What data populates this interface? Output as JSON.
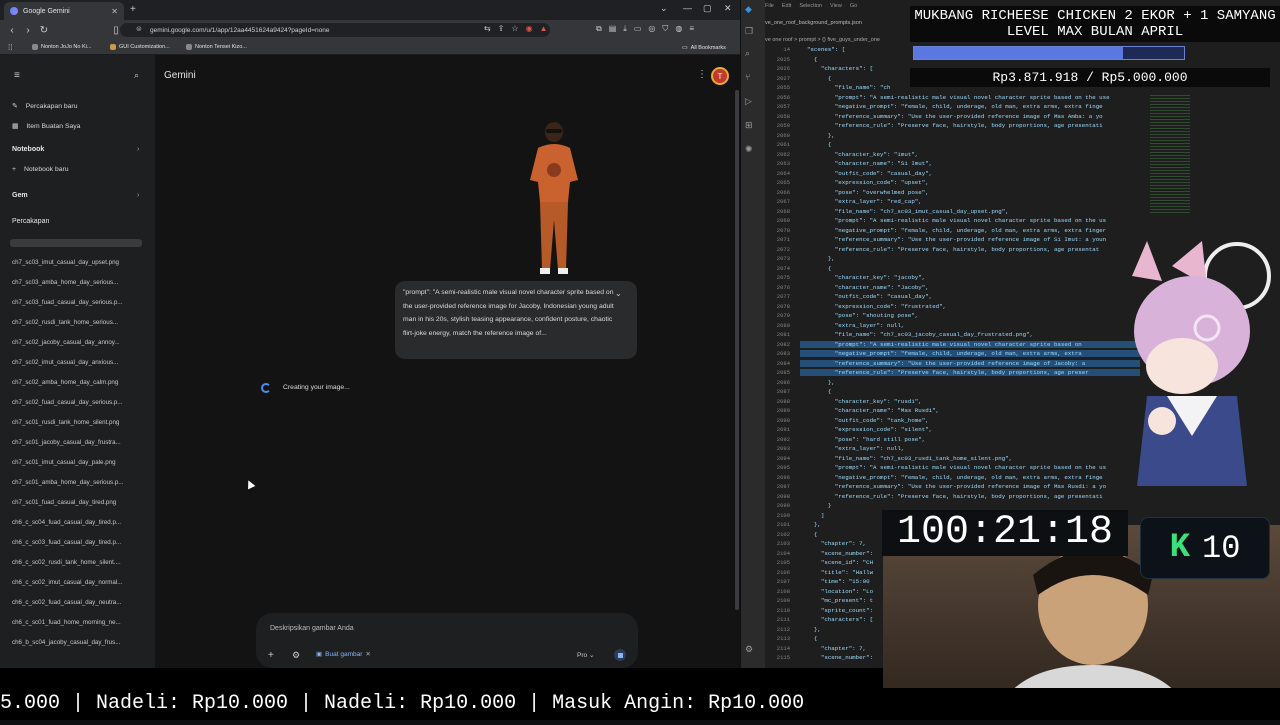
{
  "browser": {
    "tab_title": "Google Gemini",
    "url": "gemini.google.com/u/1/app/12aa4451624a9424?pageId=none",
    "bookmarks": [
      "Nonton JoJo No Ki...",
      "GUI Customization...",
      "Nonton Tensei Kizo..."
    ],
    "all_bookmarks": "All Bookmarks"
  },
  "gemini": {
    "title": "Gemini",
    "avatar_initial": "T",
    "sidebar": {
      "new_chat": "Percakapan baru",
      "my_items": "Item Buatan Saya",
      "notebook_head": "Notebook",
      "new_notebook": "Notebook baru",
      "gem_head": "Gem",
      "chats_head": "Percakapan",
      "history": [
        "ch7_sc03_imut_casual_day_upset.png",
        "ch7_sc03_amba_home_day_serious...",
        "ch7_sc03_fuad_casual_day_serious.p...",
        "ch7_sc02_rusdi_tank_home_serious...",
        "ch7_sc02_jacoby_casual_day_annoy...",
        "ch7_sc02_imut_casual_day_anxious...",
        "ch7_sc02_amba_home_day_calm.png",
        "ch7_sc02_fuad_casual_day_serious.p...",
        "ch7_sc01_rusdi_tank_home_silent.png",
        "ch7_sc01_jacoby_casual_day_frustra...",
        "ch7_sc01_imut_casual_day_pale.png",
        "ch7_sc01_amba_home_day_serious.p...",
        "ch7_sc01_fuad_casual_day_tired.png",
        "ch6_c_sc04_fuad_casual_day_tired.p...",
        "ch6_c_sc03_fuad_casual_day_tired.p...",
        "ch6_c_sc02_rusdi_tank_home_silent....",
        "ch6_c_sc02_imut_casual_day_normal...",
        "ch6_c_sc02_fuad_casual_day_neutra...",
        "ch6_c_sc01_fuad_home_morning_ne...",
        "ch6_b_sc04_jacoby_casual_day_frus..."
      ]
    },
    "prompt_text": "\"prompt\": \"A semi-realistic male visual novel character sprite based on the user-provided reference image for Jacoby, Indonesian young adult man in his 20s, stylish teasing appearance, confident posture, chaotic flirt-joke energy, match the reference image of...",
    "status": "Creating your image...",
    "input_placeholder": "Deskripsikan gambar Anda",
    "chip_label": "Buat gambar",
    "model": "Pro"
  },
  "editor": {
    "menu": [
      "File",
      "Edit",
      "Selection",
      "View",
      "Go"
    ],
    "file_tab": "ve_one_roof_background_prompts.json",
    "breadcrumb": "ve one roof > prompt > {} five_guys_under_one",
    "lines": [
      {
        "n": "14",
        "t": "  \"scenes\": ["
      },
      {
        "n": "2025",
        "t": "    {"
      },
      {
        "n": "2026",
        "t": "      \"characters\": ["
      },
      {
        "n": "2027",
        "t": "        {"
      },
      {
        "n": "2055",
        "t": "          \"file_name\": \"ch"
      },
      {
        "n": "2056",
        "t": "          \"prompt\": \"A semi-realistic male visual novel character sprite based on the use"
      },
      {
        "n": "2057",
        "t": "          \"negative_prompt\": \"female, child, underage, old man, extra arms, extra finge"
      },
      {
        "n": "2058",
        "t": "          \"reference_summary\": \"Use the user-provided reference image of Mas Amba: a yo"
      },
      {
        "n": "2059",
        "t": "          \"reference_rule\": \"Preserve face, hairstyle, body proportions, age presentati"
      },
      {
        "n": "2060",
        "t": "        },"
      },
      {
        "n": "2061",
        "t": "        {"
      },
      {
        "n": "2062",
        "t": "          \"character_key\": \"imut\","
      },
      {
        "n": "2063",
        "t": "          \"character_name\": \"Si Imut\","
      },
      {
        "n": "2064",
        "t": "          \"outfit_code\": \"casual_day\","
      },
      {
        "n": "2065",
        "t": "          \"expression_code\": \"upset\","
      },
      {
        "n": "2066",
        "t": "          \"pose\": \"overwhelmed pose\","
      },
      {
        "n": "2067",
        "t": "          \"extra_layer\": \"red_cap\","
      },
      {
        "n": "2068",
        "t": "          \"file_name\": \"ch7_sc03_imut_casual_day_upset.png\","
      },
      {
        "n": "2069",
        "t": "          \"prompt\": \"A semi-realistic male visual novel character sprite based on the us"
      },
      {
        "n": "2070",
        "t": "          \"negative_prompt\": \"female, child, underage, old man, extra arms, extra finger"
      },
      {
        "n": "2071",
        "t": "          \"reference_summary\": \"Use the user-provided reference image of Si Imut: a youn"
      },
      {
        "n": "2072",
        "t": "          \"reference_rule\": \"Preserve face, hairstyle, body proportions, age presentat"
      },
      {
        "n": "2073",
        "t": "        },"
      },
      {
        "n": "2074",
        "t": "        {"
      },
      {
        "n": "2075",
        "t": "          \"character_key\": \"jacoby\","
      },
      {
        "n": "2076",
        "t": "          \"character_name\": \"Jacoby\","
      },
      {
        "n": "2077",
        "t": "          \"outfit_code\": \"casual_day\","
      },
      {
        "n": "2078",
        "t": "          \"expression_code\": \"frustrated\","
      },
      {
        "n": "2079",
        "t": "          \"pose\": \"shouting pose\","
      },
      {
        "n": "2080",
        "t": "          \"extra_layer\": null,"
      },
      {
        "n": "2081",
        "t": "          \"file_name\": \"ch7_sc03_jacoby_casual_day_frustrated.png\","
      },
      {
        "n": "2082",
        "t": "          \"prompt\": \"A semi-realistic male visual novel character sprite based on"
      },
      {
        "n": "2083",
        "t": "          \"negative_prompt\": \"female, child, underage, old man, extra arms, extra"
      },
      {
        "n": "2084",
        "t": "          \"reference_summary\": \"Use the user-provided reference image of Jacoby: a"
      },
      {
        "n": "2085",
        "t": "          \"reference_rule\": \"Preserve face, hairstyle, body proportions, age preser"
      },
      {
        "n": "2086",
        "t": "        },"
      },
      {
        "n": "2087",
        "t": "        {"
      },
      {
        "n": "2088",
        "t": "          \"character_key\": \"rusdi\","
      },
      {
        "n": "2089",
        "t": "          \"character_name\": \"Mas Rusdi\","
      },
      {
        "n": "2090",
        "t": "          \"outfit_code\": \"tank_home\","
      },
      {
        "n": "2091",
        "t": "          \"expression_code\": \"silent\","
      },
      {
        "n": "2092",
        "t": "          \"pose\": \"hard still pose\","
      },
      {
        "n": "2093",
        "t": "          \"extra_layer\": null,"
      },
      {
        "n": "2094",
        "t": "          \"file_name\": \"ch7_sc03_rusdi_tank_home_silent.png\","
      },
      {
        "n": "2095",
        "t": "          \"prompt\": \"A semi-realistic male visual novel character sprite based on the us"
      },
      {
        "n": "2096",
        "t": "          \"negative_prompt\": \"female, child, underage, old man, extra arms, extra finge"
      },
      {
        "n": "2097",
        "t": "          \"reference_summary\": \"Use the user-provided reference image of Mas Rusdi: a yo"
      },
      {
        "n": "2098",
        "t": "          \"reference_rule\": \"Preserve face, hairstyle, body proportions, age presentati"
      },
      {
        "n": "2099",
        "t": "        }"
      },
      {
        "n": "2100",
        "t": "      ]"
      },
      {
        "n": "2101",
        "t": "    },"
      },
      {
        "n": "2102",
        "t": "    {"
      },
      {
        "n": "2103",
        "t": "      \"chapter\": 7,"
      },
      {
        "n": "2104",
        "t": "      \"scene_number\":"
      },
      {
        "n": "2105",
        "t": "      \"scene_id\": \"CH"
      },
      {
        "n": "2106",
        "t": "      \"title\": \"Hallw"
      },
      {
        "n": "2107",
        "t": "      \"time\": \"15:00"
      },
      {
        "n": "2108",
        "t": "      \"location\": \"Lo"
      },
      {
        "n": "2109",
        "t": "      \"mc_present\": t"
      },
      {
        "n": "2110",
        "t": "      \"sprite_count\":"
      },
      {
        "n": "2111",
        "t": "      \"characters\": ["
      },
      {
        "n": "2112",
        "t": "    },"
      },
      {
        "n": "2113",
        "t": "    {"
      },
      {
        "n": "2114",
        "t": "      \"chapter\": 7,"
      },
      {
        "n": "2115",
        "t": "      \"scene_number\":"
      },
      {
        "n": "2116",
        "t": "      \"scene_id\": \"CH"
      }
    ]
  },
  "overlay": {
    "title": "MUKBANG RICHEESE CHICKEN 2 EKOR + 1 SAMYANG LEVEL MAX BULAN APRIL",
    "progress_text": "Rp3.871.918 / Rp5.000.000",
    "progress_fraction": 0.774,
    "timer": "100:21:18",
    "counter_letter": "K",
    "counter_value": "10",
    "ticker": "5.000 | Nadeli: Rp10.000 | Nadeli: Rp10.000 | Masuk Angin: Rp10.000"
  }
}
